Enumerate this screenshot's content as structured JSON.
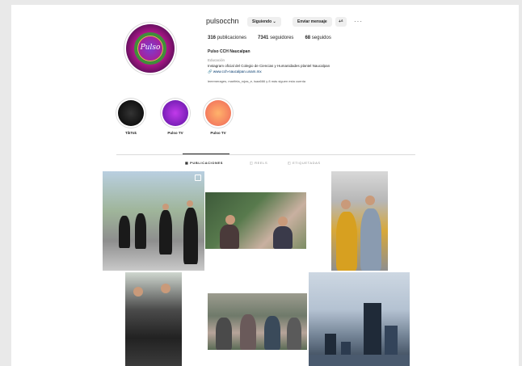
{
  "profile": {
    "username": "pulsocchn",
    "following_button": "Siguiendo ⌄",
    "message_button": "Enviar mensaje",
    "suggest_button": "+ᐞ",
    "more_button": "···",
    "stats": {
      "posts_count": "316",
      "posts_label": "publicaciones",
      "followers_count": "7341",
      "followers_label": "seguidores",
      "following_count": "68",
      "following_label": "seguidos"
    },
    "full_name": "Pulso CCH Naucalpan",
    "category": "Educación",
    "bio": "Instagram oficial del Colegio de Ciencias y Humanidades plantel Naucalpan",
    "link": "www.cch-naucalpan.unam.mx",
    "followed_by": "leeemerages, marifela_rojas_e, isaa666 y 8 más siguen esta cuenta",
    "avatar_text": "Pulso"
  },
  "highlights": [
    {
      "label": "TikTok"
    },
    {
      "label": "Pulso TV"
    },
    {
      "label": "Pulso TV"
    }
  ],
  "tabs": {
    "posts": "▦ PUBLICACIONES",
    "reels": "◫ REELS",
    "tagged": "◰ ETIQUETADAS"
  }
}
